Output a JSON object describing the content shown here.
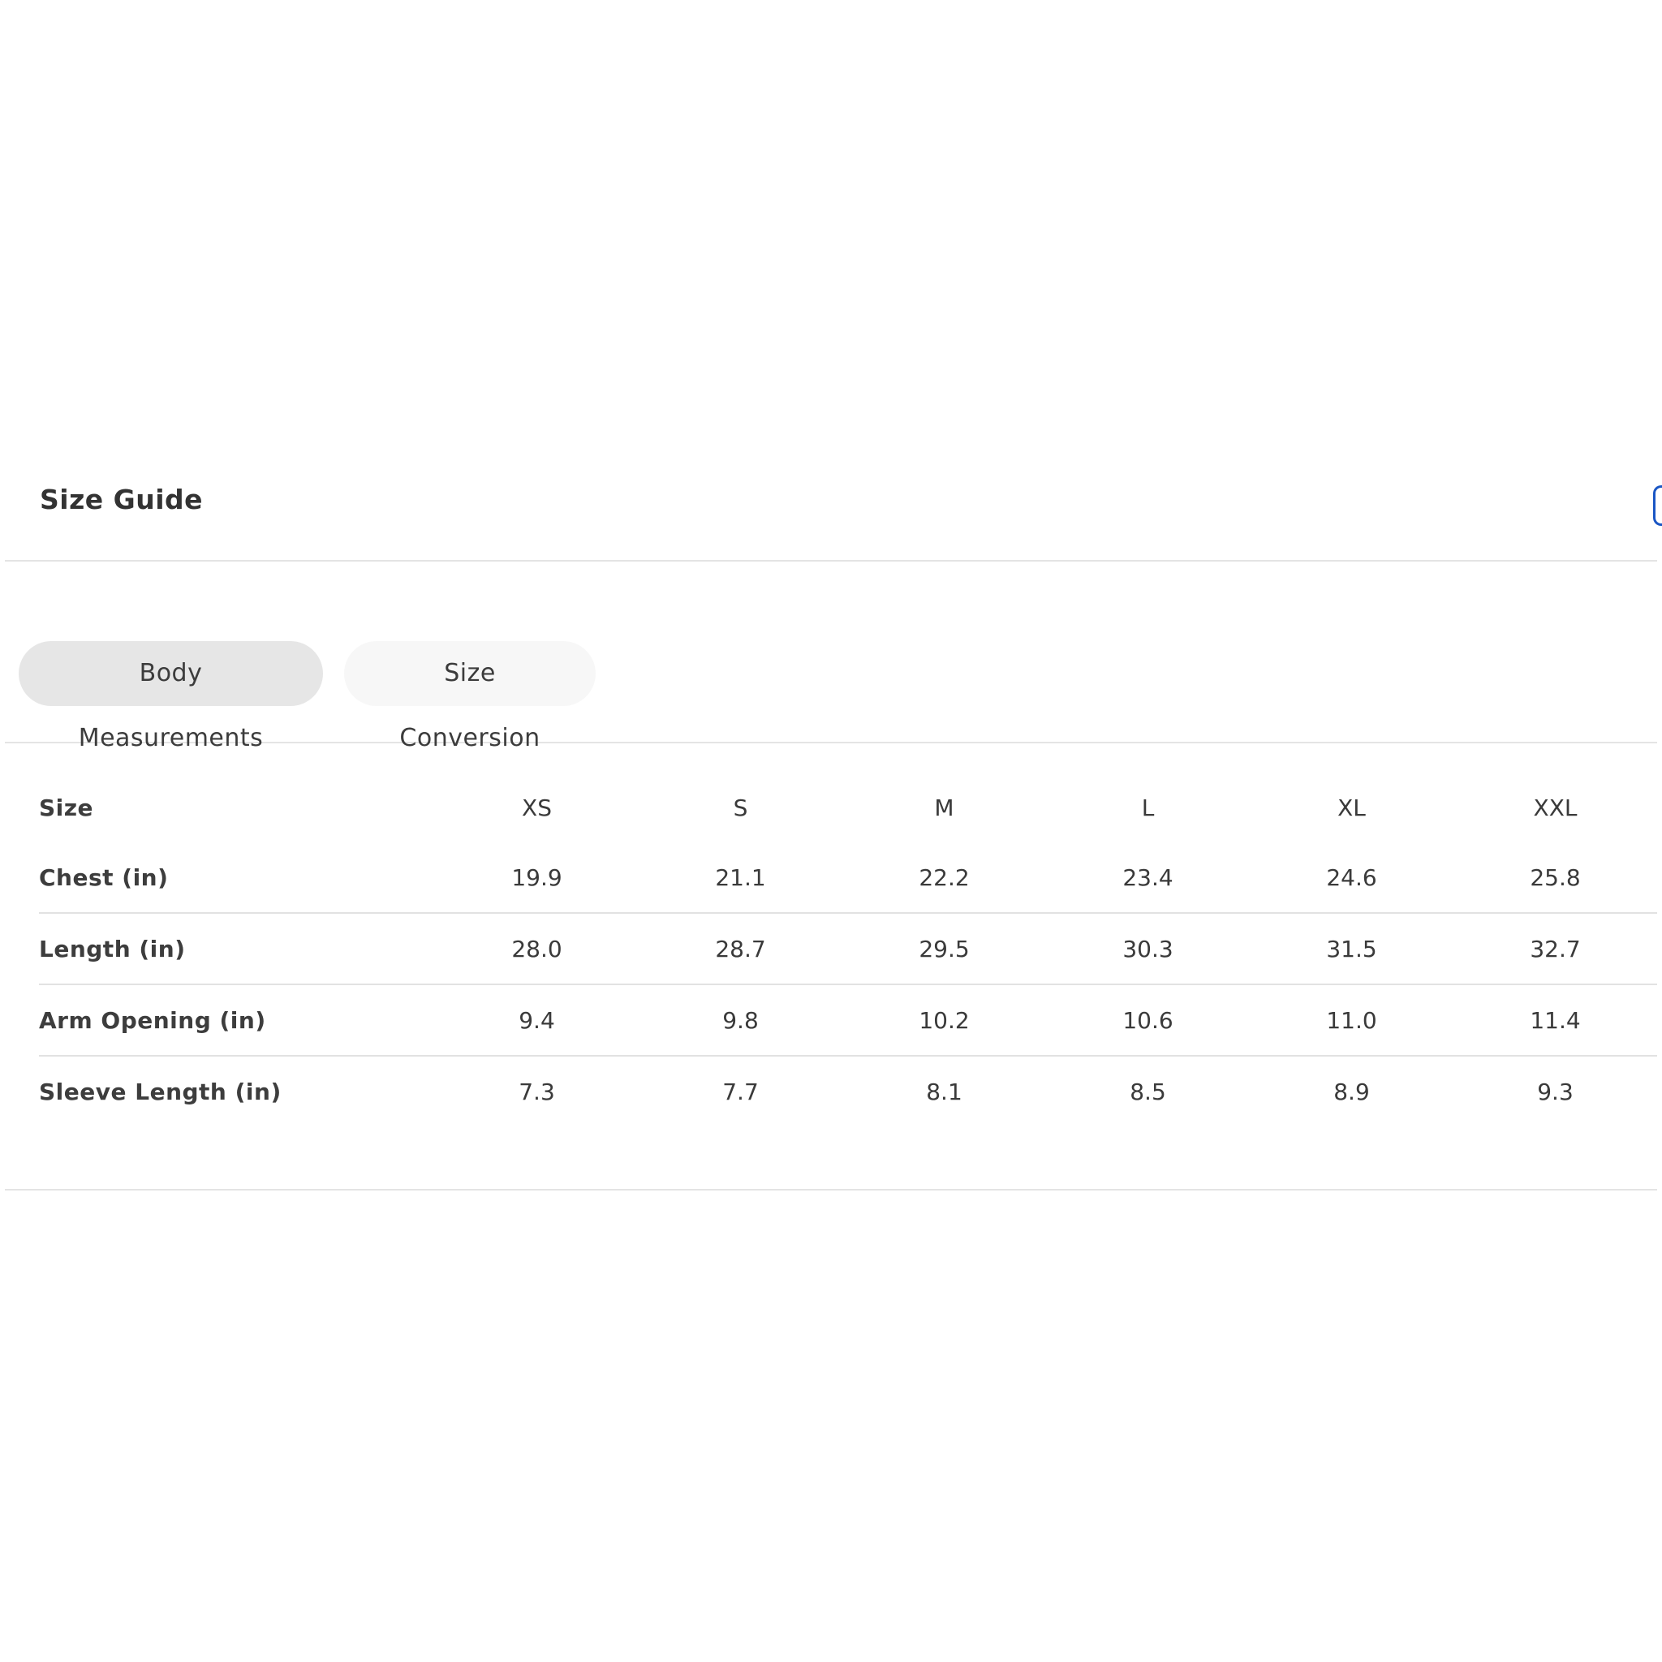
{
  "title": "Size Guide",
  "tabs": [
    {
      "label": "Body Measurements",
      "active": true
    },
    {
      "label": "Size Conversion",
      "active": false
    }
  ],
  "table": {
    "header": [
      "Size",
      "XS",
      "S",
      "M",
      "L",
      "XL",
      "XXL"
    ],
    "rows": [
      {
        "label": "Chest (in)",
        "values": [
          "19.9",
          "21.1",
          "22.2",
          "23.4",
          "24.6",
          "25.8"
        ]
      },
      {
        "label": "Length (in)",
        "values": [
          "28.0",
          "28.7",
          "29.5",
          "30.3",
          "31.5",
          "32.7"
        ]
      },
      {
        "label": "Arm Opening (in)",
        "values": [
          "9.4",
          "9.8",
          "10.2",
          "10.6",
          "11.0",
          "11.4"
        ]
      },
      {
        "label": "Sleeve Length (in)",
        "values": [
          "7.3",
          "7.7",
          "8.1",
          "8.5",
          "8.9",
          "9.3"
        ]
      }
    ]
  },
  "colors": {
    "active_tab_bg": "#e6e6e6",
    "inactive_tab_bg": "#f7f7f7",
    "divider": "#e4e4e4",
    "text": "#3a3a3a",
    "edge_accent": "#1a56c4"
  }
}
